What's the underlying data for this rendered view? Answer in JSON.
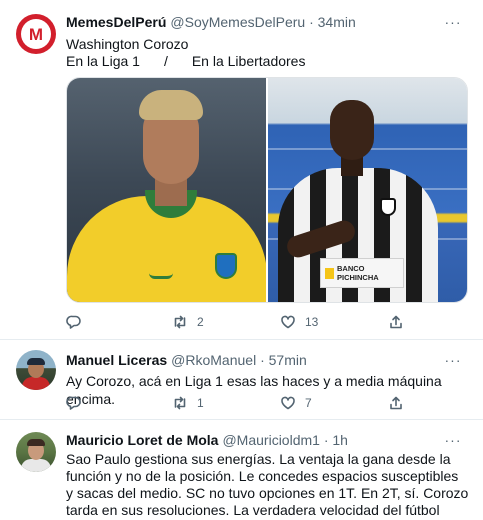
{
  "tweets": [
    {
      "author_name": "MemesDelPerú",
      "handle_time": "@SoyMemesDelPeru · 34min",
      "avatar_letter": "M",
      "text_line1": "Washington Corozo",
      "text_line2_left": "En la Liga 1",
      "text_line2_sep": "/",
      "text_line2_right": "En la Libertadores",
      "sponsor_line1": "BANCO",
      "sponsor_line2": "PICHINCHA",
      "reply_count": "",
      "retweet_count": "2",
      "like_count": "13"
    },
    {
      "author_name": "Manuel Liceras",
      "handle_time": "@RkoManuel · 57min",
      "text": "Ay Corozo, acá en Liga 1 esas las haces y a media máquina encima.",
      "reply_count": "",
      "retweet_count": "1",
      "like_count": "7"
    },
    {
      "author_name": "Mauricio Loret de Mola",
      "handle_time": "@Mauricioldm1 · 1h",
      "text": "Sao Paulo gestiona sus energías. La ventaja la gana desde la función y no de la posición. Le concedes espacios susceptibles y sacas del medio. SC no tuvo opciones en 1T. En 2T, sí. Corozo tarda en sus resoluciones. La verdadera velocidad del fútbol está en la toma de decisiones."
    }
  ],
  "more_label": "···",
  "colors": {
    "text_primary": "#0f1419",
    "text_secondary": "#536471",
    "divider": "#e6ecf0",
    "avatar_red": "#d21f2c"
  },
  "icons": [
    "reply-icon",
    "retweet-icon",
    "like-icon",
    "share-icon",
    "more-icon"
  ]
}
